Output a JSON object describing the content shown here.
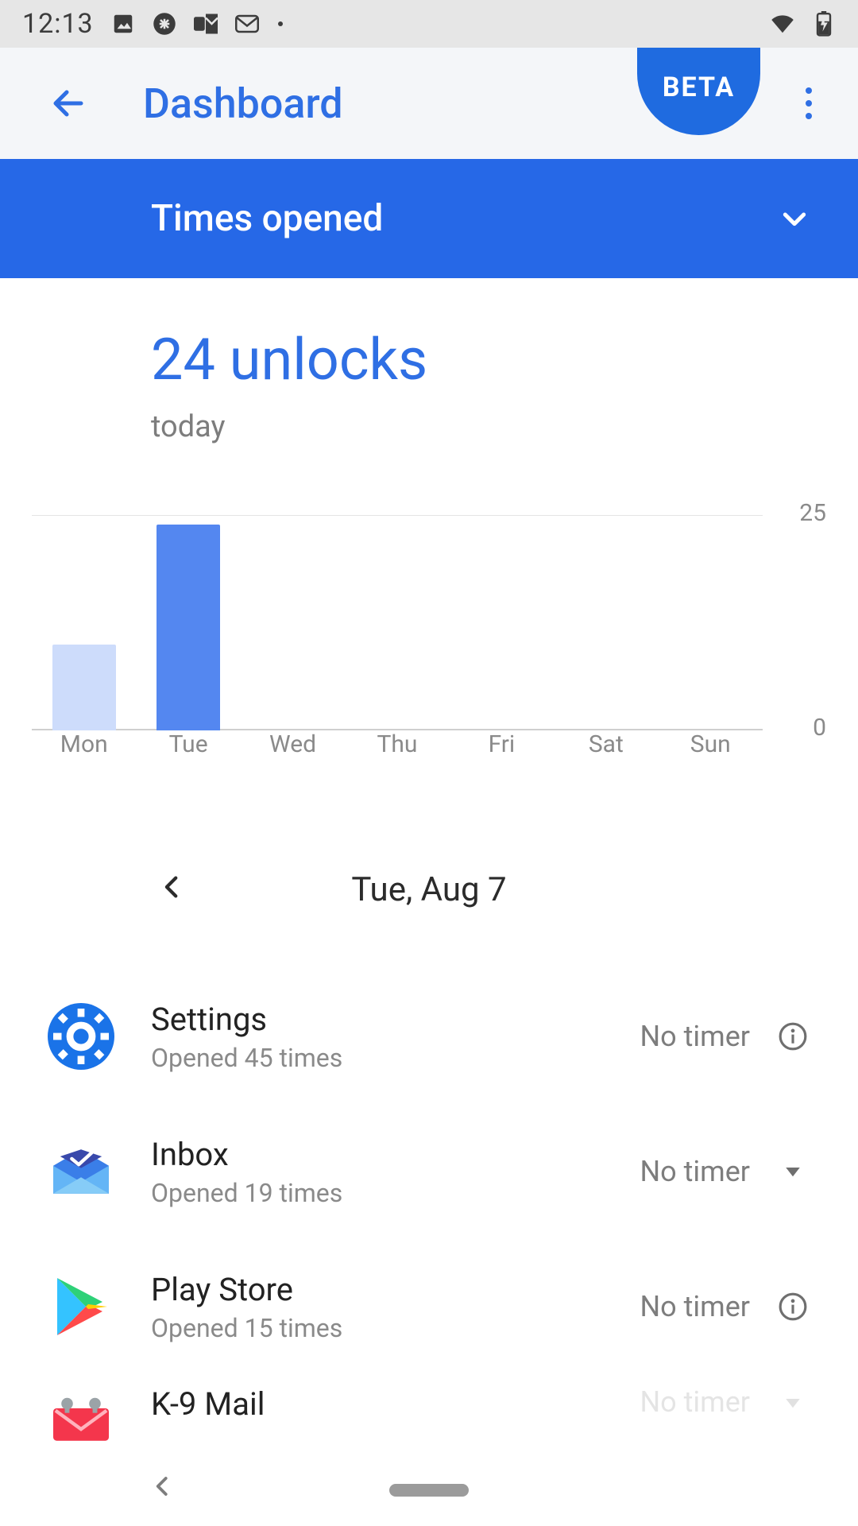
{
  "statusbar": {
    "clock": "12:13"
  },
  "appbar": {
    "title": "Dashboard",
    "beta": "BETA"
  },
  "selector": {
    "label": "Times opened"
  },
  "headline": {
    "value": "24 unlocks",
    "sub": "today"
  },
  "datenav": {
    "label": "Tue, Aug 7"
  },
  "list": {
    "timer_none": "No timer",
    "items": [
      {
        "name": "Settings",
        "sub": "Opened 45 times"
      },
      {
        "name": "Inbox",
        "sub": "Opened 19 times"
      },
      {
        "name": "Play Store",
        "sub": "Opened 15 times"
      },
      {
        "name": "K-9 Mail",
        "sub": ""
      }
    ]
  },
  "chart_data": {
    "type": "bar",
    "categories": [
      "Mon",
      "Tue",
      "Wed",
      "Thu",
      "Fri",
      "Sat",
      "Sun"
    ],
    "values": [
      10,
      24,
      0,
      0,
      0,
      0,
      0
    ],
    "selected_index": 1,
    "title": "",
    "xlabel": "",
    "ylabel": "",
    "ylim": [
      0,
      25
    ],
    "yticks": [
      0,
      25
    ],
    "bar_color_default": "#cddcfb",
    "bar_color_selected": "#5487f0"
  }
}
